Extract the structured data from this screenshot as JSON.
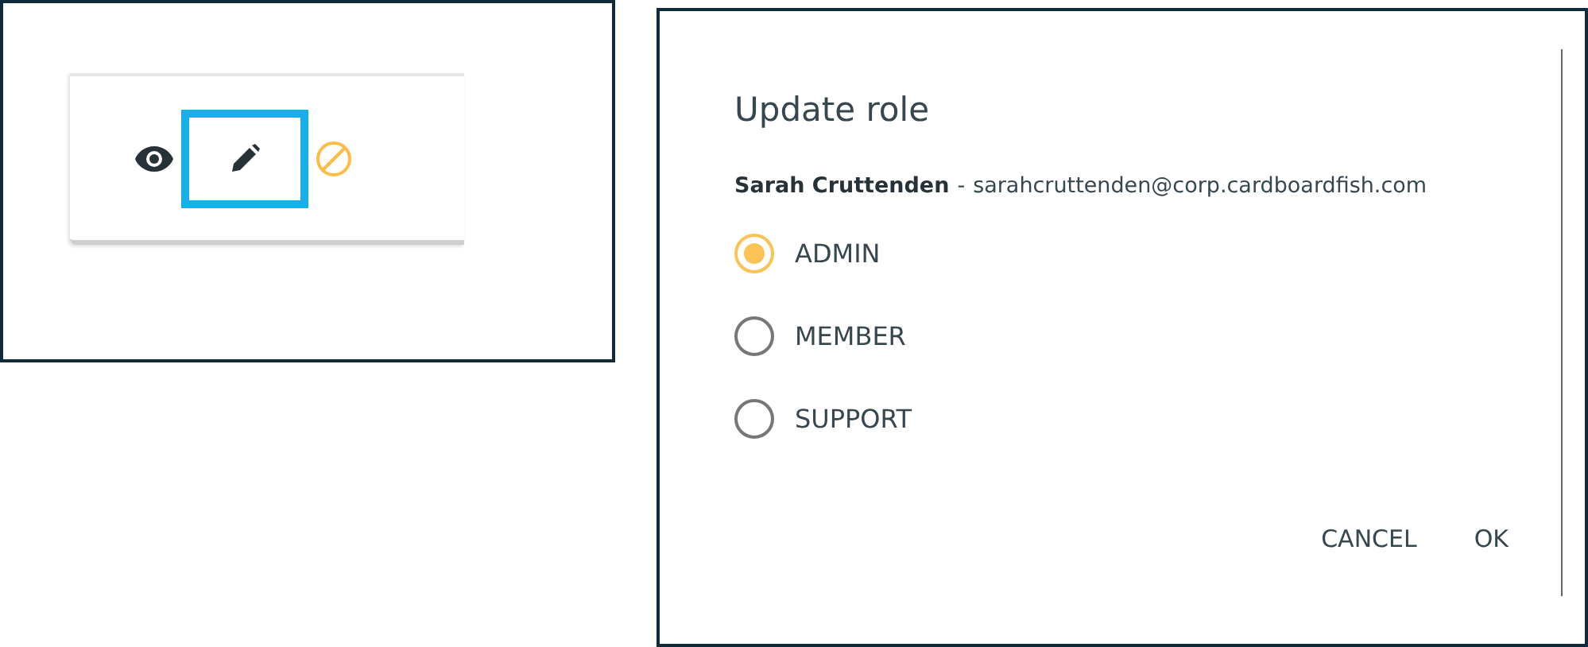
{
  "row_actions": [
    {
      "kind": "view",
      "highlighted": false
    },
    {
      "kind": "edit",
      "highlighted": true
    },
    {
      "kind": "disable",
      "highlighted": false
    }
  ],
  "dialog": {
    "title": "Update role",
    "user_name": "Sarah Cruttenden",
    "separator": "-",
    "email": "sarahcruttenden@corp.cardboardfish.com",
    "roles": [
      {
        "label": "ADMIN",
        "selected": true
      },
      {
        "label": "MEMBER",
        "selected": false
      },
      {
        "label": "SUPPORT",
        "selected": false
      }
    ],
    "buttons": [
      "CANCEL",
      "OK"
    ]
  }
}
